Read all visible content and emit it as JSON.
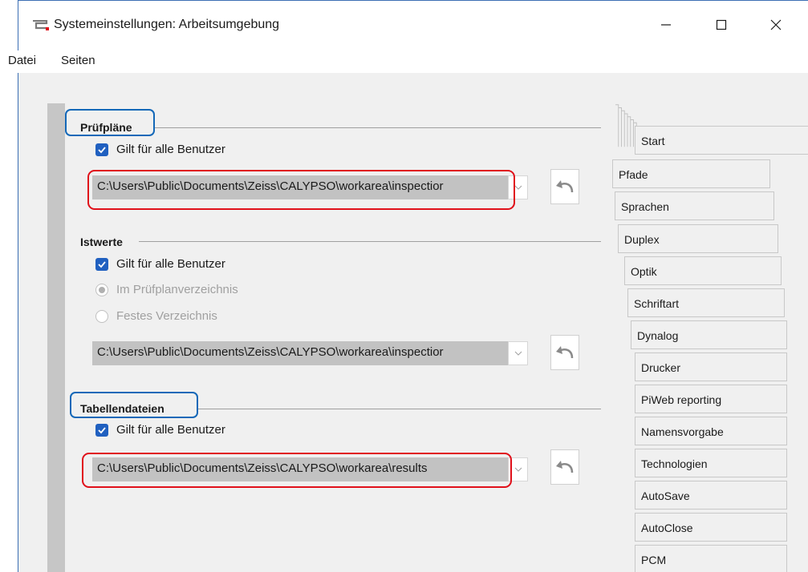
{
  "window": {
    "title": "Systemeinstellungen: Arbeitsumgebung",
    "controls": [
      "minimize-icon",
      "maximize-icon",
      "close-icon"
    ]
  },
  "menu": {
    "items": [
      "Datei",
      "Seiten"
    ]
  },
  "groups": {
    "pruefplaene": {
      "title": "Prüfpläne",
      "checkbox_label": "Gilt für alle Benutzer",
      "checked": true,
      "path": "C:\\Users\\Public\\Documents\\Zeiss\\CALYPSO\\workarea\\inspectior"
    },
    "istwerte": {
      "title": "Istwerte",
      "checkbox_label": "Gilt für alle Benutzer",
      "checked": true,
      "radio_1": "Im Prüfplanverzeichnis",
      "radio_2": "Festes Verzeichnis",
      "path": "C:\\Users\\Public\\Documents\\Zeiss\\CALYPSO\\workarea\\inspectior"
    },
    "tabellendateien": {
      "title": "Tabellendateien",
      "checkbox_label": "Gilt für alle Benutzer",
      "checked": true,
      "path": "C:\\Users\\Public\\Documents\\Zeiss\\CALYPSO\\workarea\\results"
    }
  },
  "tabs": [
    "Start",
    "Pfade",
    "Sprachen",
    "Duplex",
    "Optik",
    "Schriftart",
    "Dynalog",
    "Drucker",
    "PiWeb reporting",
    "Namensvorgabe",
    "Technologien",
    "AutoSave",
    "AutoClose",
    "PCM"
  ],
  "colors": {
    "highlight_red": "#e0101a",
    "highlight_blue": "#1468b8",
    "checkbox_blue": "#2060c0",
    "path_field_bg": "#c2c2c2"
  }
}
